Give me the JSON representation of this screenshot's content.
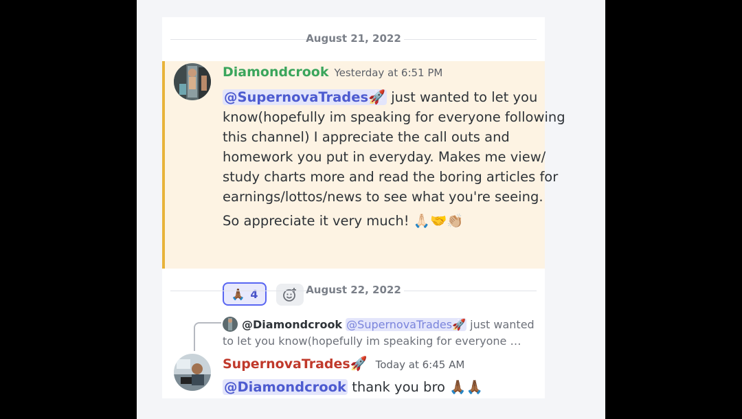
{
  "divider1": {
    "date": "August 21, 2022"
  },
  "divider2": {
    "date": "August 22, 2022"
  },
  "message1": {
    "username": "Diamondcrook",
    "username_color": "#3ba55c",
    "timestamp": "Yesterday at 6:51 PM",
    "mention": "@SupernovaTrades",
    "mention_emoji": "🚀",
    "line1": " just wanted to let you",
    "line2": "know(hopefully im speaking for everyone following",
    "line3": "this channel) I appreciate the call outs and",
    "line4": "homework you put in everyday. Makes me view/",
    "line5": "study charts more and read the boring articles for",
    "line6": "earnings/lottos/news to see what you're seeing.",
    "line7": "So appreciate it very much! ",
    "line7_emojis": "🙏🏻🤝👏🏼",
    "reaction_emoji": "🙏🏾",
    "reaction_count": "4",
    "highlight_color": "#fdf3e3"
  },
  "reply": {
    "author": "@Diamondcrook",
    "mention": "@SupernovaTrades",
    "mention_emoji": "🚀",
    "line1": " just wanted",
    "line2": "to let you know(hopefully im speaking for everyone …"
  },
  "message2": {
    "username": "SupernovaTrades",
    "username_emoji": "🚀",
    "username_color": "#c0392b",
    "timestamp": "Today at 6:45 AM",
    "mention": "@Diamondcrook",
    "text": " thank you bro ",
    "emojis": "🙏🏾🙏🏾"
  },
  "icons": {
    "add_reaction": "add-reaction-icon",
    "avatar1": "avatar",
    "avatar2": "avatar"
  }
}
